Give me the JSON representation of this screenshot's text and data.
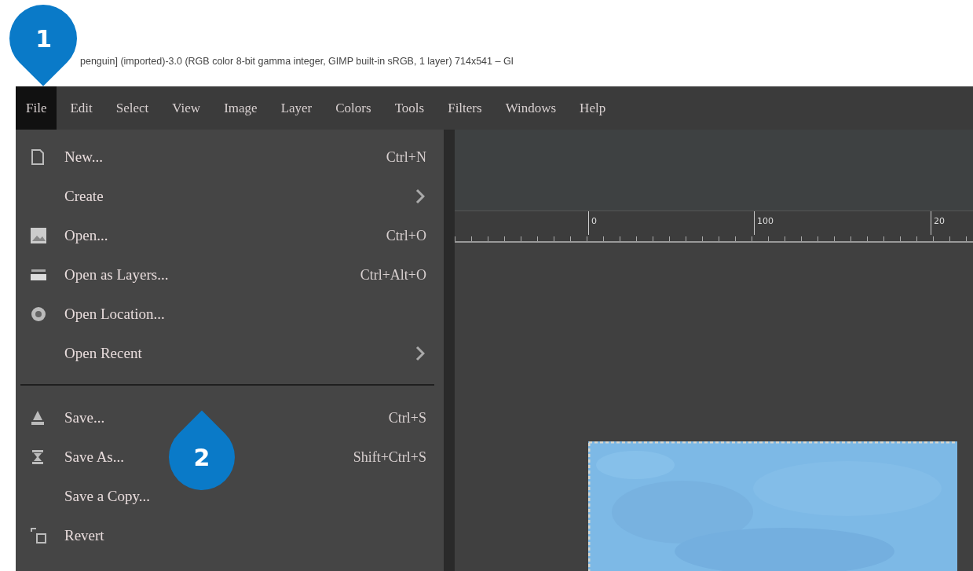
{
  "window": {
    "title": "penguin] (imported)-3.0 (RGB color 8-bit gamma integer, GIMP built-in sRGB, 1 layer) 714x541 – GI"
  },
  "menubar": [
    {
      "label": "File",
      "selected": true
    },
    {
      "label": "Edit",
      "selected": false
    },
    {
      "label": "Select",
      "selected": false
    },
    {
      "label": "View",
      "selected": false
    },
    {
      "label": "Image",
      "selected": false
    },
    {
      "label": "Layer",
      "selected": false
    },
    {
      "label": "Colors",
      "selected": false
    },
    {
      "label": "Tools",
      "selected": false
    },
    {
      "label": "Filters",
      "selected": false
    },
    {
      "label": "Windows",
      "selected": false
    },
    {
      "label": "Help",
      "selected": false
    }
  ],
  "file_menu": [
    {
      "kind": "item",
      "label": "New...",
      "shortcut": "Ctrl+N"
    },
    {
      "kind": "submenu",
      "label": "Create"
    },
    {
      "kind": "item",
      "label": "Open...",
      "shortcut": "Ctrl+O"
    },
    {
      "kind": "item",
      "label": "Open as Layers...",
      "shortcut": "Ctrl+Alt+O"
    },
    {
      "kind": "item",
      "label": "Open Location..."
    },
    {
      "kind": "submenu",
      "label": "Open Recent"
    },
    {
      "kind": "separator"
    },
    {
      "kind": "item",
      "label": "Save...",
      "shortcut": "Ctrl+S"
    },
    {
      "kind": "item",
      "label": "Save As...",
      "shortcut": "Shift+Ctrl+S"
    },
    {
      "kind": "item",
      "label": "Save a Copy..."
    },
    {
      "kind": "item",
      "label": "Revert"
    }
  ],
  "ruler": {
    "labels": [
      "0",
      "100",
      "20"
    ]
  },
  "callouts": [
    {
      "number": "1"
    },
    {
      "number": "2"
    }
  ]
}
